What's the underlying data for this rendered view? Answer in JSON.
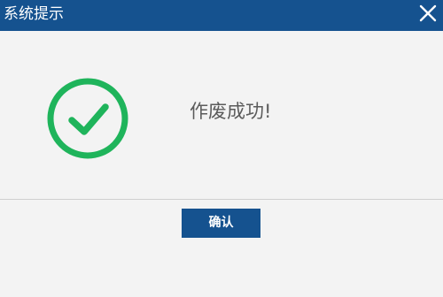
{
  "dialog": {
    "title": "系统提示",
    "message": "作废成功!",
    "confirm_label": "确认"
  },
  "icons": {
    "close": "close-icon",
    "status": "check-circle-icon"
  },
  "colors": {
    "titlebar": "#15528f",
    "success": "#1fb45b",
    "button": "#15528f",
    "background": "#f3f3f3"
  }
}
